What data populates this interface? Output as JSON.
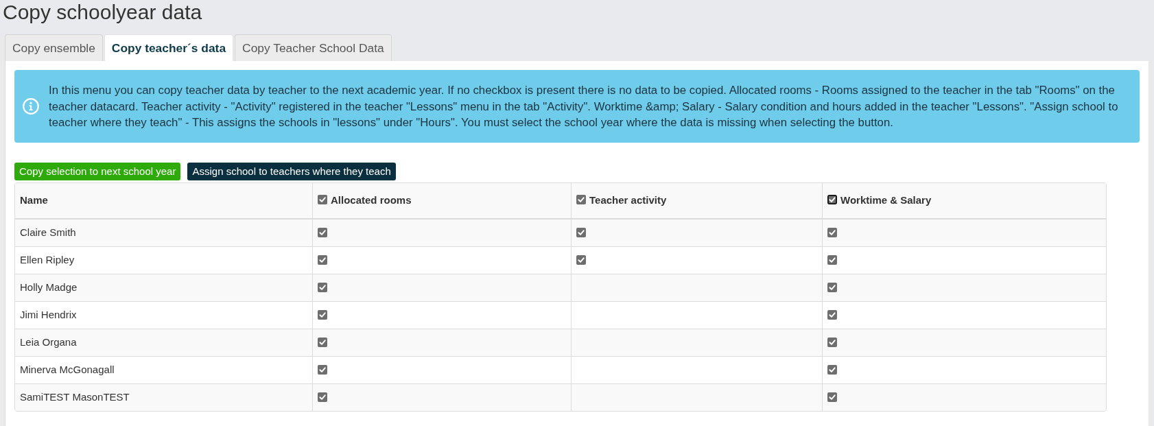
{
  "page": {
    "title": "Copy schoolyear data"
  },
  "tabs": [
    {
      "label": "Copy ensemble",
      "selected": false
    },
    {
      "label": "Copy teacher´s data",
      "selected": true
    },
    {
      "label": "Copy Teacher School Data",
      "selected": false
    }
  ],
  "info": {
    "text": "In this menu you can copy teacher data by teacher to the next academic year. If no checkbox is present there is no data to be copied. Allocated rooms - Rooms assigned to the teacher in the tab \"Rooms\" on the teacher datacard. Teacher activity - \"Activity\" registered in the teacher \"Lessons\" menu in the tab \"Activity\". Worktime &amp; Salary - Salary condition and hours added in the teacher \"Lessons\". \"Assign school to teacher where they teach\" - This assigns the schools in \"lessons\" under \"Hours\". You must select the school year where the data is missing when selecting the button."
  },
  "buttons": [
    {
      "label": "Copy selection to next school year",
      "kind": "success"
    },
    {
      "label": "Assign school to teachers where they teach",
      "kind": "dark"
    }
  ],
  "table": {
    "columns": [
      {
        "label": "Name",
        "kind": "text"
      },
      {
        "label": "Allocated rooms",
        "kind": "checkbox",
        "checked": true,
        "focused": false
      },
      {
        "label": "Teacher activity",
        "kind": "checkbox",
        "checked": true,
        "focused": false
      },
      {
        "label": "Worktime & Salary",
        "kind": "checkbox",
        "checked": true,
        "focused": true
      }
    ],
    "rows": [
      {
        "name": "Claire Smith",
        "cells": [
          {
            "checked": true
          },
          {
            "checked": true
          },
          {
            "checked": true
          }
        ]
      },
      {
        "name": "Ellen Ripley",
        "cells": [
          {
            "checked": true
          },
          {
            "checked": true
          },
          {
            "checked": true
          }
        ]
      },
      {
        "name": "Holly Madge",
        "cells": [
          {
            "checked": true
          },
          null,
          {
            "checked": true
          }
        ]
      },
      {
        "name": "Jimi Hendrix",
        "cells": [
          {
            "checked": true
          },
          null,
          {
            "checked": true
          }
        ]
      },
      {
        "name": "Leia Organa",
        "cells": [
          {
            "checked": true
          },
          null,
          {
            "checked": true
          }
        ]
      },
      {
        "name": "Minerva McGonagall",
        "cells": [
          {
            "checked": true
          },
          null,
          {
            "checked": true
          }
        ]
      },
      {
        "name": "SamiTEST MasonTEST",
        "cells": [
          {
            "checked": true
          },
          null,
          {
            "checked": true
          }
        ]
      }
    ]
  }
}
